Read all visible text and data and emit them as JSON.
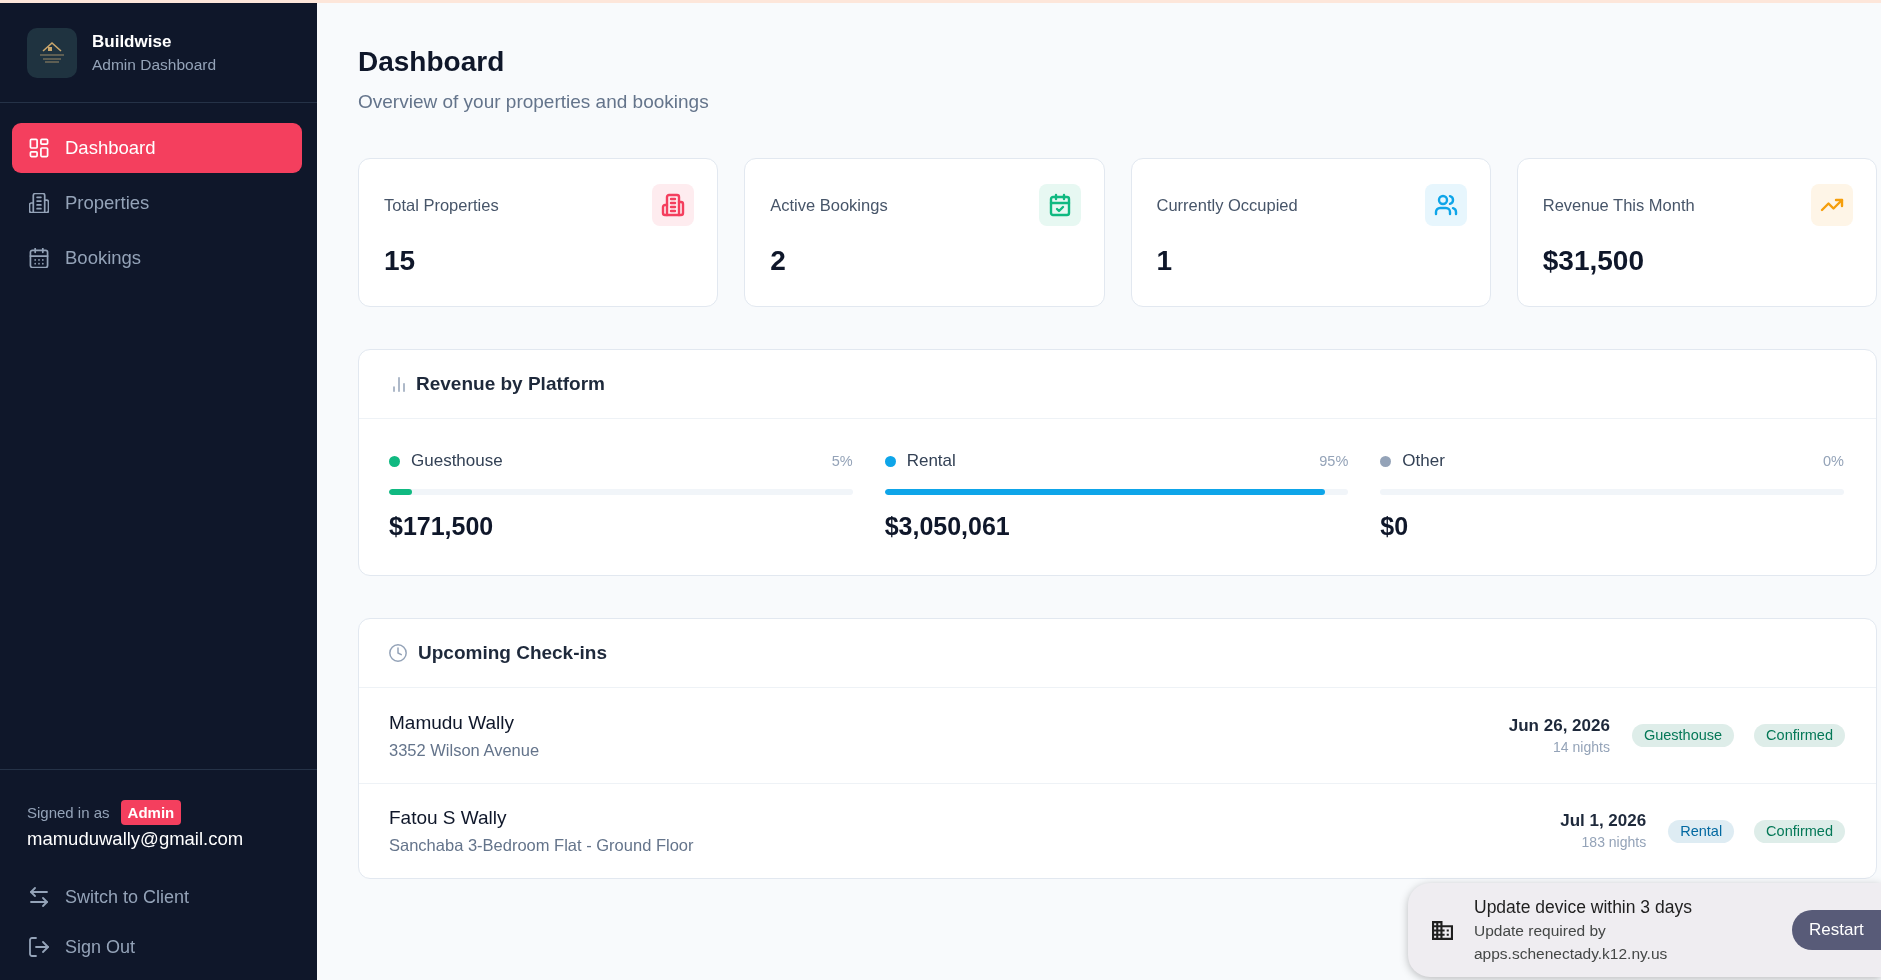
{
  "sidebar": {
    "brand": {
      "name": "Buildwise",
      "subtitle": "Admin Dashboard"
    },
    "nav": [
      {
        "label": "Dashboard",
        "kind": "grid",
        "selected": true
      },
      {
        "label": "Properties",
        "kind": "building",
        "selected": false
      },
      {
        "label": "Bookings",
        "kind": "calendar",
        "selected": false
      }
    ],
    "account": {
      "caption": "Signed in as",
      "role": "Admin",
      "email": "mamuduwally@gmail.com"
    },
    "actions": [
      {
        "label": "Switch to Client",
        "kind": "switch"
      },
      {
        "label": "Sign Out",
        "kind": "signout"
      }
    ]
  },
  "header": {
    "title": "Dashboard",
    "subtitle": "Overview of your properties and bookings"
  },
  "stats": [
    {
      "label": "Total Properties",
      "value": "15",
      "kind": "building",
      "color": "#f43f5e"
    },
    {
      "label": "Active Bookings",
      "value": "2",
      "kind": "calendar",
      "color": "#10b981"
    },
    {
      "label": "Currently Occupied",
      "value": "1",
      "kind": "people",
      "color": "#0ea5e9"
    },
    {
      "label": "Revenue This Month",
      "value": "$31,500",
      "kind": "trend",
      "color": "#f59e0b"
    }
  ],
  "revenue": {
    "title": "Revenue by Platform",
    "platforms": [
      {
        "name": "Guesthouse",
        "percent": "5%",
        "level": 0.05,
        "amount": "$171,500",
        "color": "#10b981"
      },
      {
        "name": "Rental",
        "percent": "95%",
        "level": 0.95,
        "amount": "$3,050,061",
        "color": "#0ea5e9"
      },
      {
        "name": "Other",
        "percent": "0%",
        "level": 0,
        "amount": "$0",
        "color": "#94a3b8"
      }
    ]
  },
  "checkins": {
    "title": "Upcoming Check-ins",
    "rows": [
      {
        "guest": "Mamudu Wally",
        "property": "3352 Wilson Avenue",
        "date": "Jun 26, 2026",
        "nights": "14 nights",
        "platform": {
          "label": "Guesthouse",
          "color": "#047857"
        },
        "status": {
          "label": "Confirmed",
          "color": "#047857"
        }
      },
      {
        "guest": "Fatou S Wally",
        "property": "Sanchaba 3-Bedroom Flat - Ground Floor",
        "date": "Jul 1, 2026",
        "nights": "183 nights",
        "platform": {
          "label": "Rental",
          "color": "#0369a1"
        },
        "status": {
          "label": "Confirmed",
          "color": "#047857"
        }
      }
    ]
  },
  "toast": {
    "title": "Update device within 3 days",
    "message": "Update required by",
    "domain": "apps.schenectady.k12.ny.us",
    "button": "Restart"
  }
}
